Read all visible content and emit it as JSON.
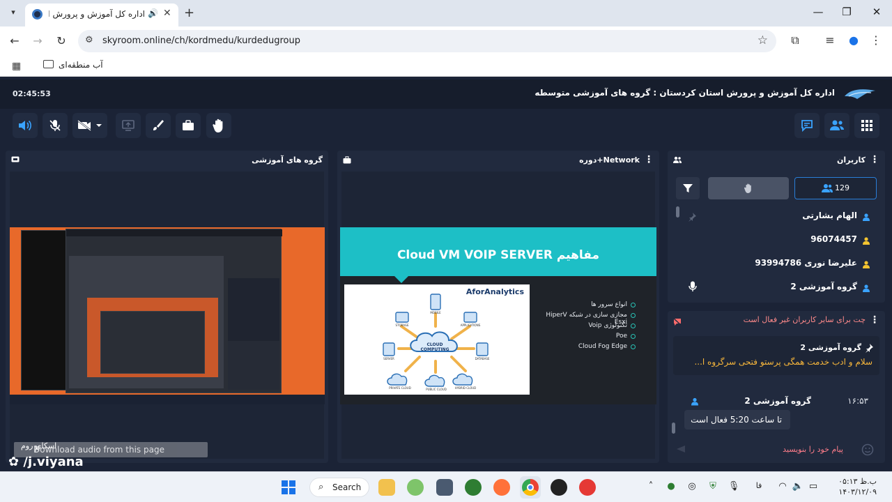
{
  "browser": {
    "tab_title": "اداره کل آموزش و پرورش است",
    "url": "skyroom.online/ch/kordmedu/kurdedugroup",
    "bookmark_label": "آب منطقه‌ای"
  },
  "app": {
    "clock": "02:45:53",
    "room_title": "اداره کل آموزش و پرورش استان کردستان : گروه های آموزشی متوسطه"
  },
  "panels": {
    "screen_title": "گروه های آموزشی",
    "slide_panel_title": "Network+دوره",
    "users_title": "کاربران"
  },
  "slide": {
    "title": "مفاهیم Cloud VM VOIP SERVER",
    "brand": "AforAnalytics",
    "center_label_1": "CLOUD",
    "center_label_2": "COMPUTING",
    "diagram_labels": [
      "MOBILE",
      "STORAGE",
      "APPLICATIONS",
      "SERVER",
      "DATABASE",
      "PRIVATE CLOUD",
      "PUBLIC CLOUD",
      "HYBRID CLOUD"
    ],
    "bullets": [
      "انواع سرور ها",
      "مجازی سازی در شبکه HiperV Esxi",
      "تکنولوژی Voip",
      "Poe",
      "Cloud Fog Edge"
    ]
  },
  "users": {
    "count": "129",
    "list": [
      {
        "name": "الهام بشارتی",
        "color": "#3aa3ff"
      },
      {
        "name": "96074457",
        "color": "#f4c430"
      },
      {
        "name": "علیرضا نوری 93994786",
        "color": "#f4c430"
      },
      {
        "name": "گروه آموزشی 2",
        "color": "#3aa3ff"
      }
    ]
  },
  "chat": {
    "banner": "چت برای سایر کاربران غیر فعال است",
    "pinned_sender": "گروه آموزشی 2",
    "pinned_message": "سلام و ادب خدمت همگی پرستو فتحی سرگروه ا...",
    "message_sender": "گروه آموزشی 2",
    "message_time": "۱۶:۵۳",
    "message_text": "تا ساعت 5:20 فعال است",
    "composer_placeholder": "پیام خود را بنویسید"
  },
  "overlay": {
    "download_audio": "Download audio from this page",
    "watermark": "/j.viyana",
    "watermark_sub": "اسکای روم"
  },
  "taskbar": {
    "search_label": "Search",
    "lang": "فا",
    "time": "۰۵:۱۳ ب.ظ",
    "date": "۱۴۰۳/۱۲/۰۹"
  },
  "colors": {
    "accent": "#2a7ed8",
    "slide_teal": "#1dbfc6",
    "panel_bg": "#212a3e",
    "app_bg": "#1b2336"
  }
}
